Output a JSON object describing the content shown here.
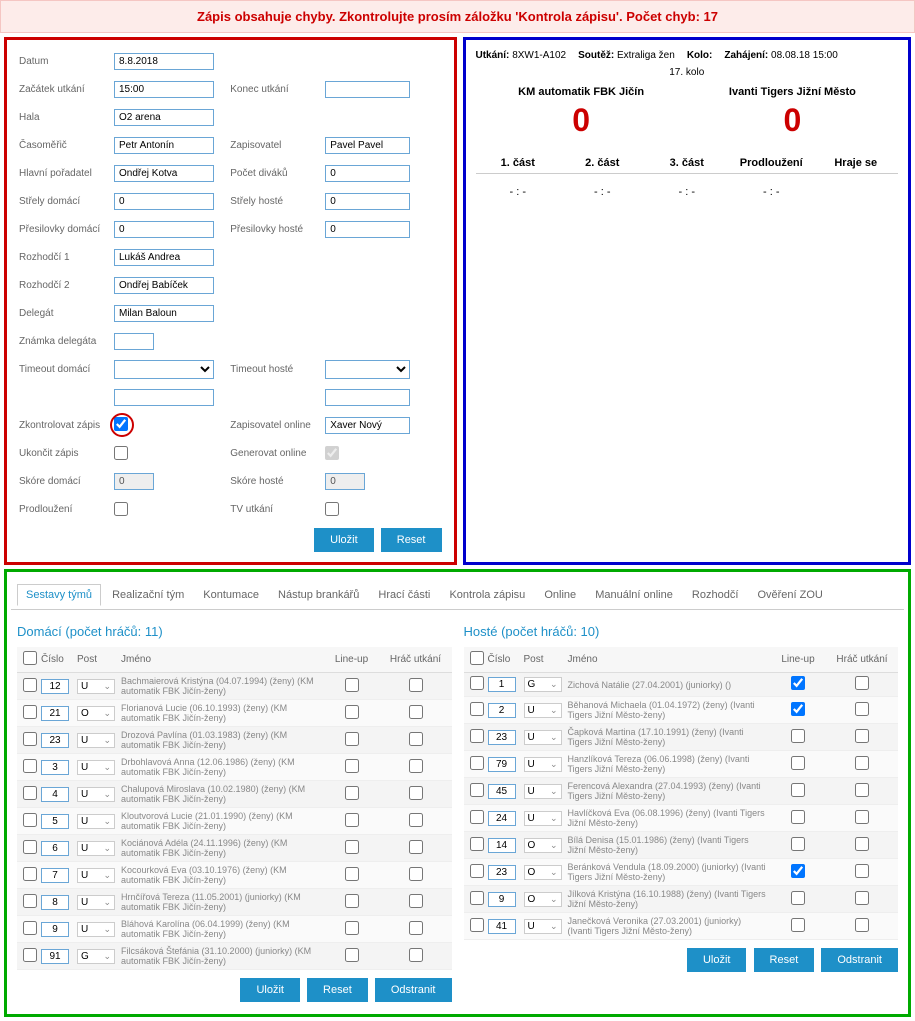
{
  "error_banner": "Zápis obsahuje chyby. Zkontrolujte prosím záložku 'Kontrola zápisu'. Počet chyb: 17",
  "form": {
    "datum_label": "Datum",
    "datum": "8.8.2018",
    "zacatek_label": "Začátek utkání",
    "zacatek": "15:00",
    "konec_label": "Konec utkání",
    "konec": "",
    "hala_label": "Hala",
    "hala": "O2 arena",
    "casomeric_label": "Časoměřič",
    "casomeric": "Petr Antonín",
    "zapisovatel_label": "Zapisovatel",
    "zapisovatel": "Pavel Pavel",
    "hlavni_label": "Hlavní pořadatel",
    "hlavni": "Ondřej Kotva",
    "divaku_label": "Počet diváků",
    "divaku": "0",
    "strely_dom_label": "Střely domácí",
    "strely_dom": "0",
    "strely_host_label": "Střely hosté",
    "strely_host": "0",
    "presilovky_dom_label": "Přesilovky domácí",
    "presilovky_dom": "0",
    "presilovky_host_label": "Přesilovky hosté",
    "presilovky_host": "0",
    "rozhodci1_label": "Rozhodčí 1",
    "rozhodci1": "Lukáš Andrea",
    "rozhodci2_label": "Rozhodčí 2",
    "rozhodci2": "Ondřej Babíček",
    "delegat_label": "Delegát",
    "delegat": "Milan Baloun",
    "znamka_label": "Známka delegáta",
    "znamka": "",
    "timeout_dom_label": "Timeout domácí",
    "timeout_host_label": "Timeout hosté",
    "zkontrolovan_label": "Zkontrolovat zápis",
    "zapisovatel_online_label": "Zapisovatel online",
    "zapisovatel_online": "Xaver Nový",
    "ukoncit_label": "Ukončit zápis",
    "generovat_label": "Generovat online",
    "skore_dom_label": "Skóre domácí",
    "skore_dom": "0",
    "skore_host_label": "Skóre hosté",
    "skore_host": "0",
    "prodlouzeni_label": "Prodloužení",
    "tv_label": "TV utkání",
    "ulozit": "Uložit",
    "reset": "Reset",
    "odstranit": "Odstranit"
  },
  "match": {
    "utkani_label": "Utkání:",
    "utkani": "8XW1-A102",
    "soutez_label": "Soutěž:",
    "soutez": "Extraliga žen",
    "kolo_label": "Kolo:",
    "kolo": "17. kolo",
    "zahajeni_label": "Zahájení:",
    "zahajeni": "08.08.18 15:00",
    "home_name": "KM automatik FBK Jičín",
    "home_score": "0",
    "away_name": "Ivanti Tigers Jižní Město",
    "away_score": "0",
    "p1": "1. část",
    "p2": "2. část",
    "p3": "3. část",
    "ot": "Prodloužení",
    "now": "Hraje se",
    "empty": "- : -"
  },
  "tabs": {
    "sestavy": "Sestavy týmů",
    "realizacni": "Realizační tým",
    "kontumace": "Kontumace",
    "brankaru": "Nástup brankářů",
    "hraci": "Hrací části",
    "kontrola": "Kontrola zápisu",
    "online": "Online",
    "manual": "Manuální online",
    "rozhodci": "Rozhodčí",
    "zou": "Ověření ZOU"
  },
  "roster": {
    "home_title": "Domácí  (počet hráčů: 11)",
    "away_title": "Hosté  (počet hráčů: 10)",
    "col_cislo": "Číslo",
    "col_post": "Post",
    "col_jmeno": "Jméno",
    "col_lineup": "Line-up",
    "col_match": "Hráč utkání",
    "caret": "⌄"
  },
  "home_players": [
    {
      "num": "12",
      "pos": "U",
      "name": "Bachmaierová Kristýna (04.07.1994) (ženy) (KM automatik FBK Jičín-ženy)",
      "lu": false
    },
    {
      "num": "21",
      "pos": "O",
      "name": "Florianová Lucie (06.10.1993) (ženy) (KM automatik FBK Jičín-ženy)",
      "lu": false
    },
    {
      "num": "23",
      "pos": "U",
      "name": "Drozová Pavlína (01.03.1983) (ženy) (KM automatik FBK Jičín-ženy)",
      "lu": false
    },
    {
      "num": "3",
      "pos": "U",
      "name": "Drbohlavová Anna (12.06.1986) (ženy) (KM automatik FBK Jičín-ženy)",
      "lu": false
    },
    {
      "num": "4",
      "pos": "U",
      "name": "Chalupová Miroslava (10.02.1980) (ženy) (KM automatik FBK Jičín-ženy)",
      "lu": false
    },
    {
      "num": "5",
      "pos": "U",
      "name": "Kloutvorová Lucie (21.01.1990) (ženy) (KM automatik FBK Jičín-ženy)",
      "lu": false
    },
    {
      "num": "6",
      "pos": "U",
      "name": "Kociánová Adéla (24.11.1996) (ženy) (KM automatik FBK Jičín-ženy)",
      "lu": false
    },
    {
      "num": "7",
      "pos": "U",
      "name": "Kocourková Eva (03.10.1976) (ženy) (KM automatik FBK Jičín-ženy)",
      "lu": false
    },
    {
      "num": "8",
      "pos": "U",
      "name": "Hrnčířová Tereza (11.05.2001) (juniorky) (KM automatik FBK Jičín-ženy)",
      "lu": false
    },
    {
      "num": "9",
      "pos": "U",
      "name": "Bláhová Karolína (06.04.1999) (ženy) (KM automatik FBK Jičín-ženy)",
      "lu": false
    },
    {
      "num": "91",
      "pos": "G",
      "name": "Filcsáková Štefánia (31.10.2000) (juniorky) (KM automatik FBK Jičín-ženy)",
      "lu": false
    }
  ],
  "away_players": [
    {
      "num": "1",
      "pos": "G",
      "name": "Zichová Natálie (27.04.2001) (juniorky) ()",
      "lu": true
    },
    {
      "num": "2",
      "pos": "U",
      "name": "Běhanová Michaela (01.04.1972) (ženy) (Ivanti Tigers Jižní Město-ženy)",
      "lu": true
    },
    {
      "num": "23",
      "pos": "U",
      "name": "Čapková Martina (17.10.1991) (ženy) (Ivanti Tigers Jižní Město-ženy)",
      "lu": false
    },
    {
      "num": "79",
      "pos": "U",
      "name": "Hanzlíková Tereza (06.06.1998) (ženy) (Ivanti Tigers Jižní Město-ženy)",
      "lu": false
    },
    {
      "num": "45",
      "pos": "U",
      "name": "Ferencová Alexandra (27.04.1993) (ženy) (Ivanti Tigers Jižní Město-ženy)",
      "lu": false
    },
    {
      "num": "24",
      "pos": "U",
      "name": "Havlíčková Eva (06.08.1996) (ženy) (Ivanti Tigers Jižní Město-ženy)",
      "lu": false
    },
    {
      "num": "14",
      "pos": "O",
      "name": "Bílá Denisa (15.01.1986) (ženy) (Ivanti Tigers Jižní Město-ženy)",
      "lu": false
    },
    {
      "num": "23",
      "pos": "O",
      "name": "Beránková Vendula (18.09.2000) (juniorky) (Ivanti Tigers Jižní Město-ženy)",
      "lu": true
    },
    {
      "num": "9",
      "pos": "O",
      "name": "Jílková Kristýna (16.10.1988) (ženy) (Ivanti Tigers Jižní Město-ženy)",
      "lu": false
    },
    {
      "num": "41",
      "pos": "U",
      "name": "Janečková Veronika (27.03.2001) (juniorky) (Ivanti Tigers Jižní Město-ženy)",
      "lu": false
    }
  ]
}
